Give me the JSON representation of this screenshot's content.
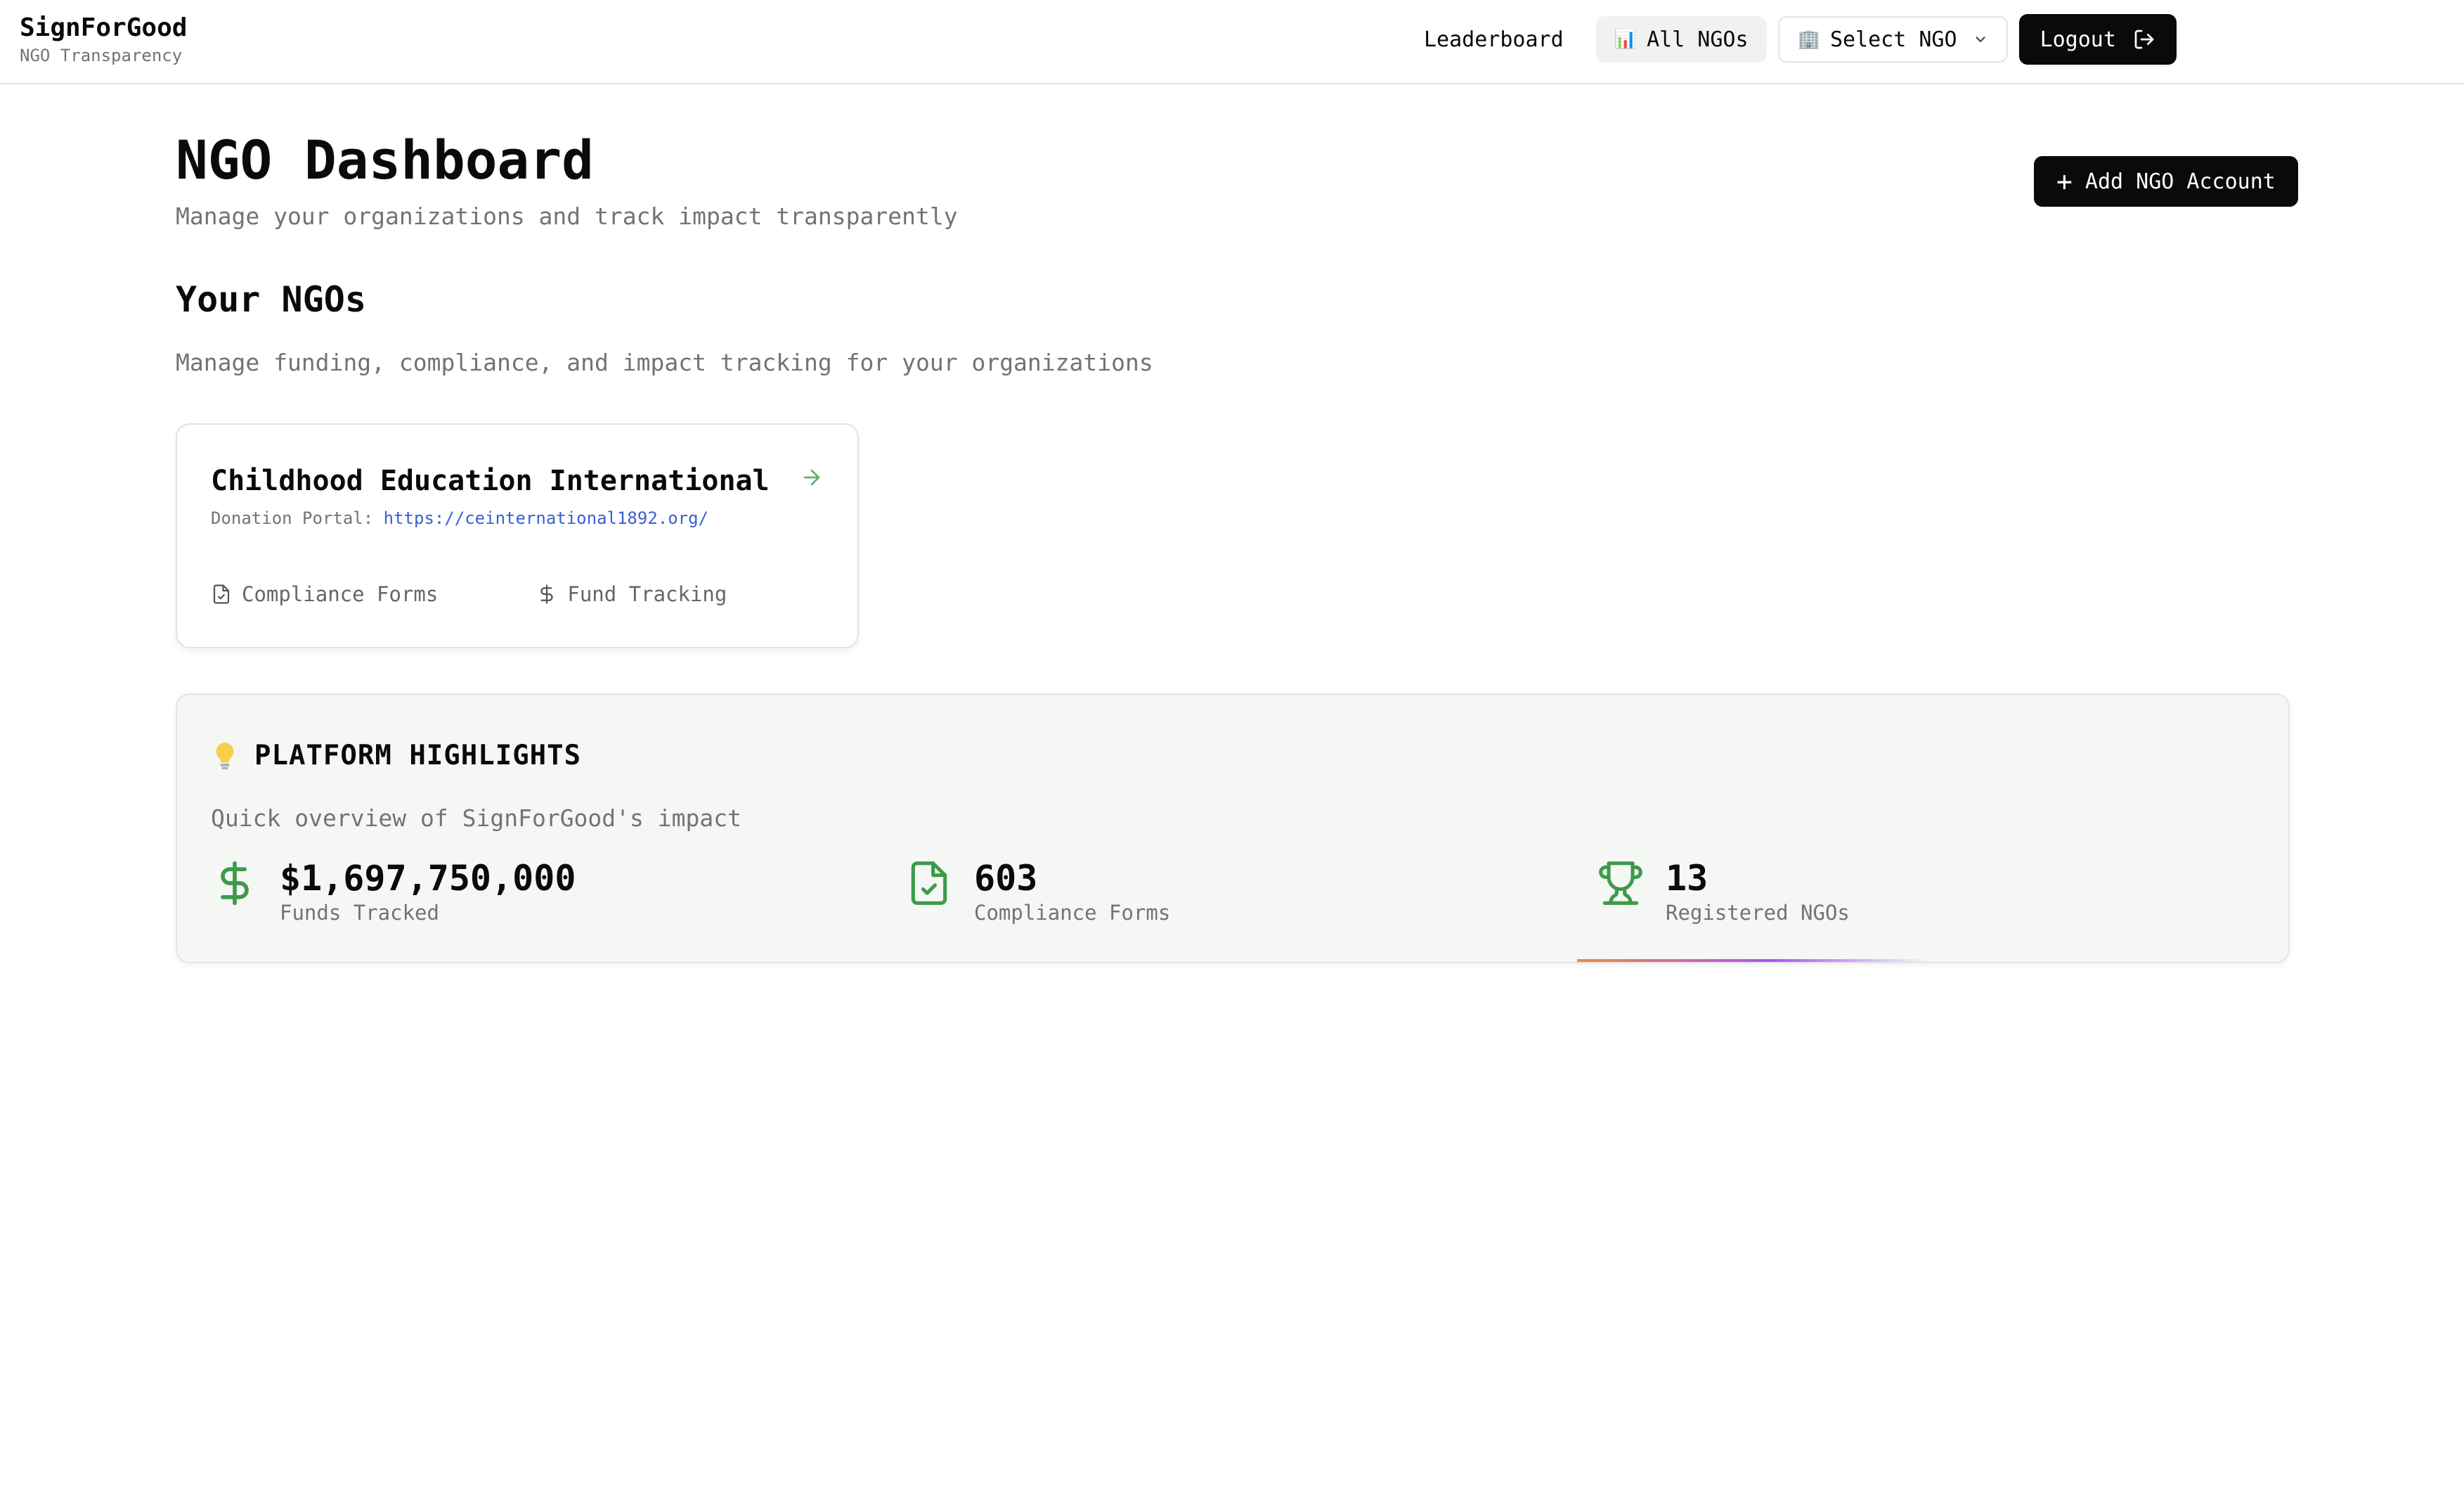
{
  "brand": {
    "title": "SignForGood",
    "subtitle": "NGO Transparency"
  },
  "nav": {
    "leaderboard": "Leaderboard",
    "all_ngos": "All NGOs",
    "all_ngos_emoji": "📊",
    "select_ngo": "Select NGO",
    "select_ngo_emoji": "🏢",
    "logout": "Logout"
  },
  "page": {
    "title": "NGO Dashboard",
    "subtitle": "Manage your organizations and track impact transparently",
    "add_button": "Add NGO Account"
  },
  "section": {
    "title": "Your NGOs",
    "subtitle": "Manage funding, compliance, and impact tracking for your organizations"
  },
  "ngo_card": {
    "name": "Childhood Education International",
    "portal_label": "Donation Portal:",
    "portal_url": "https://ceinternational1892.org/",
    "action_compliance": "Compliance Forms",
    "action_funds": "Fund Tracking"
  },
  "highlights": {
    "title": "PLATFORM HIGHLIGHTS",
    "subtitle": "Quick overview of SignForGood's impact",
    "stats": [
      {
        "value": "$1,697,750,000",
        "label": "Funds Tracked",
        "icon": "dollar-icon"
      },
      {
        "value": "603",
        "label": "Compliance Forms",
        "icon": "file-check-icon"
      },
      {
        "value": "13",
        "label": "Registered NGOs",
        "icon": "trophy-icon"
      }
    ]
  },
  "colors": {
    "accent_green": "#3e9a4a",
    "link_blue": "#3b5fd0",
    "dark": "#0a0a0a",
    "highlights_bg": "#f4f7f4"
  }
}
